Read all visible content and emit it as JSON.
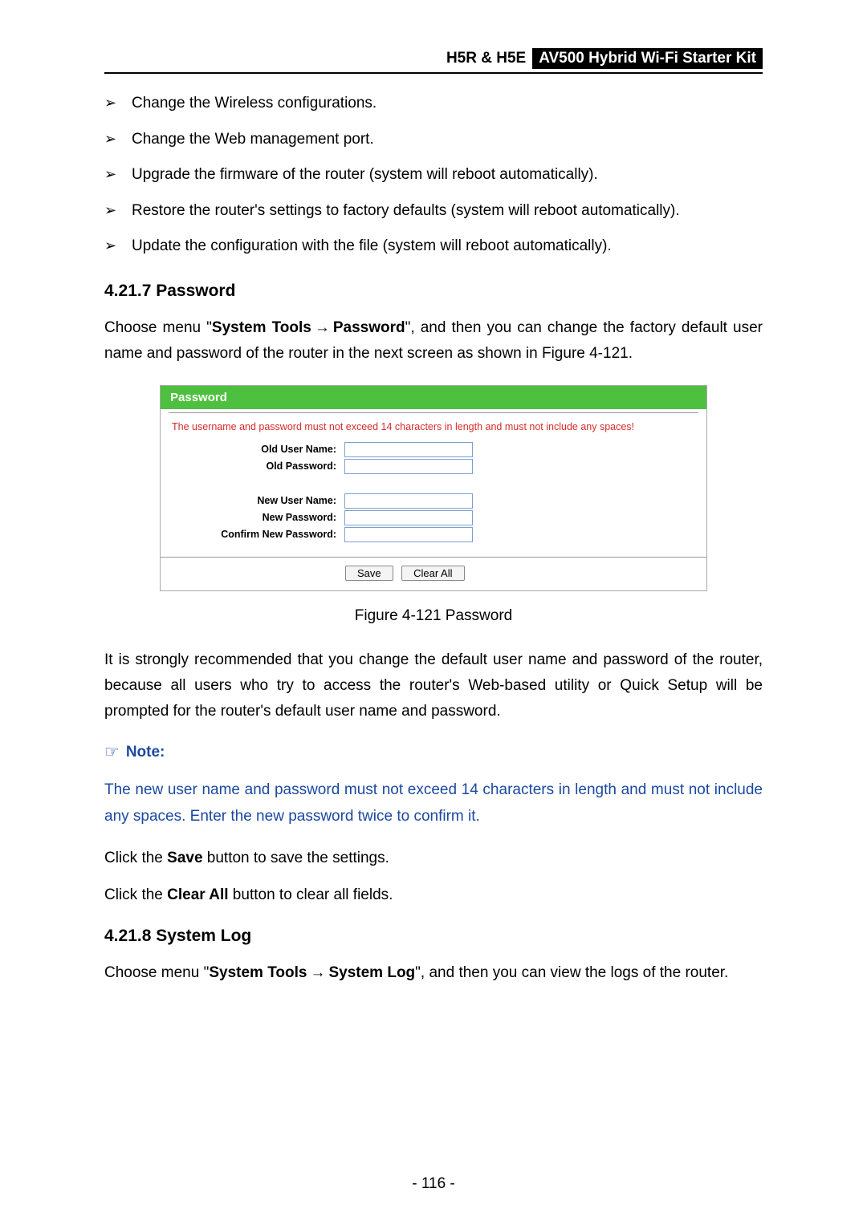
{
  "header": {
    "left": "H5R & H5E",
    "badge": "AV500 Hybrid Wi-Fi Starter Kit"
  },
  "bullets": [
    "Change the Wireless configurations.",
    "Change the Web management port.",
    "Upgrade the firmware of the router (system will reboot automatically).",
    "Restore the router's settings to factory defaults (system will reboot automatically).",
    "Update the configuration with the file (system will reboot automatically)."
  ],
  "section1": {
    "heading": "4.21.7  Password",
    "para_pre": "Choose menu \"",
    "menu1": "System Tools",
    "menu2": "Password",
    "para_post": "\", and then you can change the factory default user name and password of the router in the next screen as shown in Figure 4-121."
  },
  "figure": {
    "title": "Password",
    "warning": "The username and password must not exceed 14 characters in length and must not include any spaces!",
    "labels": {
      "old_user": "Old User Name:",
      "old_pass": "Old Password:",
      "new_user": "New User Name:",
      "new_pass": "New Password:",
      "confirm": "Confirm New Password:"
    },
    "buttons": {
      "save": "Save",
      "clear": "Clear All"
    },
    "caption": "Figure 4-121 Password"
  },
  "recommend": "It is strongly recommended that you change the default user name and password of the router, because all users who try to access the router's Web-based utility or Quick Setup will be prompted for the router's default user name and password.",
  "note": {
    "label": "Note:",
    "body": "The new user name and password must not exceed 14 characters in length and must not include any spaces. Enter the new password twice to confirm it."
  },
  "save_line": {
    "pre": "Click the ",
    "bold": "Save",
    "post": " button to save the settings."
  },
  "clear_line": {
    "pre": "Click the ",
    "bold": "Clear All",
    "post": " button to clear all fields."
  },
  "section2": {
    "heading": "4.21.8  System Log",
    "para_pre": "Choose menu \"",
    "menu1": "System Tools",
    "menu2": "System Log",
    "para_post": "\", and then you can view the logs of the router."
  },
  "page_number": "- 116 -"
}
